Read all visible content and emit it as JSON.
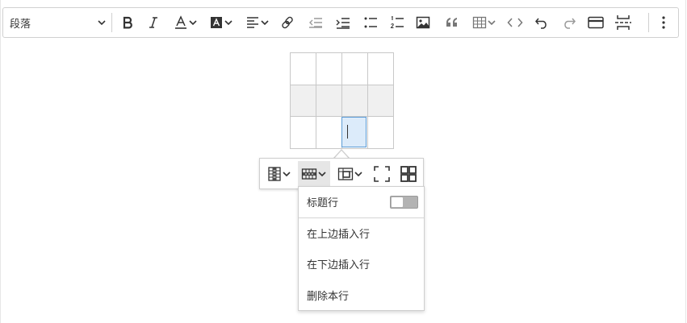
{
  "toolbar": {
    "heading_select": {
      "label": "段落",
      "icon": "chevron-down-icon"
    },
    "buttons": [
      "bold-icon",
      "italic-icon",
      "font-color-icon",
      "font-background-color-icon",
      "alignment-icon",
      "link-icon",
      "outdent-icon",
      "indent-icon",
      "bulleted-list-icon",
      "numbered-list-icon",
      "image-icon",
      "blockquote-icon",
      "insert-table-icon",
      "code-block-icon",
      "undo-icon",
      "redo-icon",
      "media-embed-icon",
      "page-break-icon",
      "more-items-icon"
    ]
  },
  "table": {
    "rows": 3,
    "cols": 4,
    "highlighted_row": 2,
    "selected_cell": {
      "row": 3,
      "col": 3
    }
  },
  "table_toolbar": {
    "buttons": [
      "table-column-icon",
      "table-row-icon",
      "merge-cells-icon",
      "table-properties-icon",
      "cell-properties-icon"
    ],
    "active": "table-row-icon"
  },
  "row_menu": {
    "header_row_label": "标题行",
    "header_row_enabled": false,
    "insert_row_above": "在上边插入行",
    "insert_row_below": "在下边插入行",
    "delete_row": "删除本行"
  },
  "colors": {
    "border": "#d0d0d0",
    "icon": "#333333",
    "disabled_icon": "#8a8a8a",
    "selection_fill": "#dcebfa",
    "selection_border": "#5b9bd5",
    "toggle_off": "#b3b3b3"
  }
}
